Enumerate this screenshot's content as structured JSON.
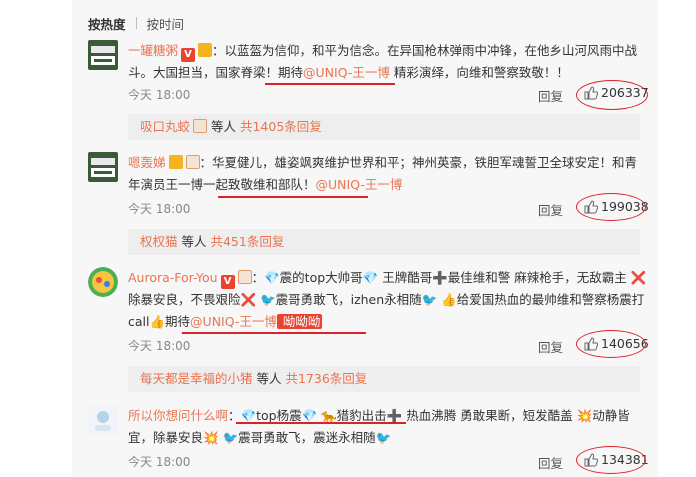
{
  "sort": {
    "hot": "按热度",
    "time": "按时间"
  },
  "comments": [
    {
      "username": "一罐糖粥",
      "text_pre": "：以蓝盔为信仰，和平为信念。在异国枪林弹雨中冲锋，在他乡山河风雨中战斗。大国担当，国家脊梁！期待",
      "mention": "@UNIQ-王一博",
      "text_post": " 精彩演绎，向维和警察致敬！！",
      "time": "今天 18:00",
      "reply": "回复",
      "likes": "206337"
    },
    {
      "username": "嗯轰娣",
      "text_pre": "：华夏健儿，雄姿飒爽维护世界和平；神州英豪，铁胆军魂誓卫全球安定！和青年演员王一博一起致敬维和部队！",
      "mention": "@UNIQ-王一博",
      "text_post": "",
      "time": "今天 18:00",
      "reply": "回复",
      "likes": "199038"
    },
    {
      "username": "Aurora-For-You",
      "text_pre": "：💎震的top大帅哥💎 王牌酷哥➕最佳维和警 麻辣枪手，无敌霸主 ❌除暴安良，不畏艰险❌ 🐦震哥勇敢飞，izhen永相随🐦 👍给爱国热血的最帅维和警察杨震打call👍期待",
      "mention": "@UNIQ-王一博",
      "text_post": " 呦呦呦",
      "time": "今天 18:00",
      "reply": "回复",
      "likes": "140656"
    },
    {
      "username": "所以你想问什么啊",
      "text_pre": "：💎top杨震💎 🐆猎豹出击➕ 热血沸腾 勇敢果断，短发酷盖 💥动静皆宜，除暴安良💥 🐦震哥勇敢飞，震迷永相随🐦",
      "mention": "",
      "text_post": "",
      "time": "今天 18:00",
      "reply": "回复",
      "likes": "134381"
    }
  ],
  "subreplies": [
    {
      "user": "吸口丸蛟",
      "mid": " 等人 ",
      "more": "共1405条回复"
    },
    {
      "user": "权权猫",
      "mid": " 等人 ",
      "more": "共451条回复"
    },
    {
      "user": "每天都是幸福的小猪",
      "mid": " 等人 ",
      "more": "共1736条回复"
    }
  ],
  "colors": {
    "accent": "#eb7350",
    "annotation": "#d9222a",
    "panel": "#f7f7f7"
  }
}
